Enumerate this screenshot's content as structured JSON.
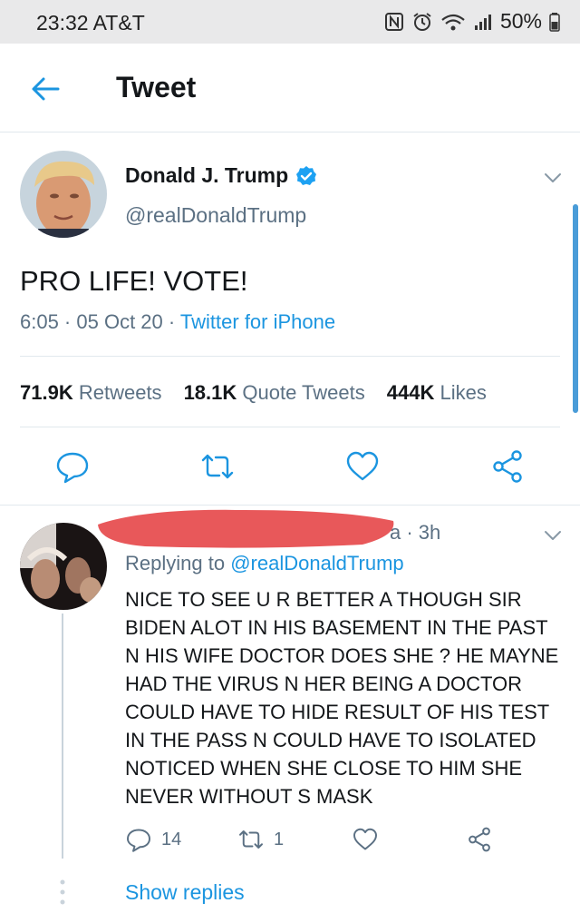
{
  "status_bar": {
    "time_carrier": "23:32 AT&T",
    "battery": "50%"
  },
  "header": {
    "title": "Tweet"
  },
  "tweet": {
    "author_name": "Donald J. Trump",
    "author_handle": "@realDonaldTrump",
    "text": "PRO LIFE! VOTE!",
    "time": "6:05 · 05 Oct 20 · ",
    "source": "Twitter for iPhone",
    "stats": {
      "retweets_count": "71.9K",
      "retweets_label": "Retweets",
      "quotes_count": "18.1K",
      "quotes_label": "Quote Tweets",
      "likes_count": "444K",
      "likes_label": "Likes"
    }
  },
  "reply": {
    "time_fragment": "a · 3h",
    "replying_label": "Replying to ",
    "replying_mention": "@realDonaldTrump",
    "text": "NICE TO SEE U R BETTER A THOUGH SIR\nBIDEN ALOT IN HIS BASEMENT IN THE PAST\nN HIS WIFE DOCTOR DOES SHE ? HE MAYNE\nHAD THE VIRUS N HER BEING A DOCTOR\nCOULD HAVE TO HIDE RESULT OF HIS TEST\nIN THE PASS   N COULD HAVE TO ISOLATED\nNOTICED WHEN SHE CLOSE TO HIM SHE\nNEVER WITHOUT S MASK",
    "reply_count": "14",
    "retweet_count": "1",
    "show_replies": "Show replies"
  },
  "colors": {
    "accent": "#1b95e0",
    "muted": "#5b7083",
    "redaction": "#e8585a"
  }
}
